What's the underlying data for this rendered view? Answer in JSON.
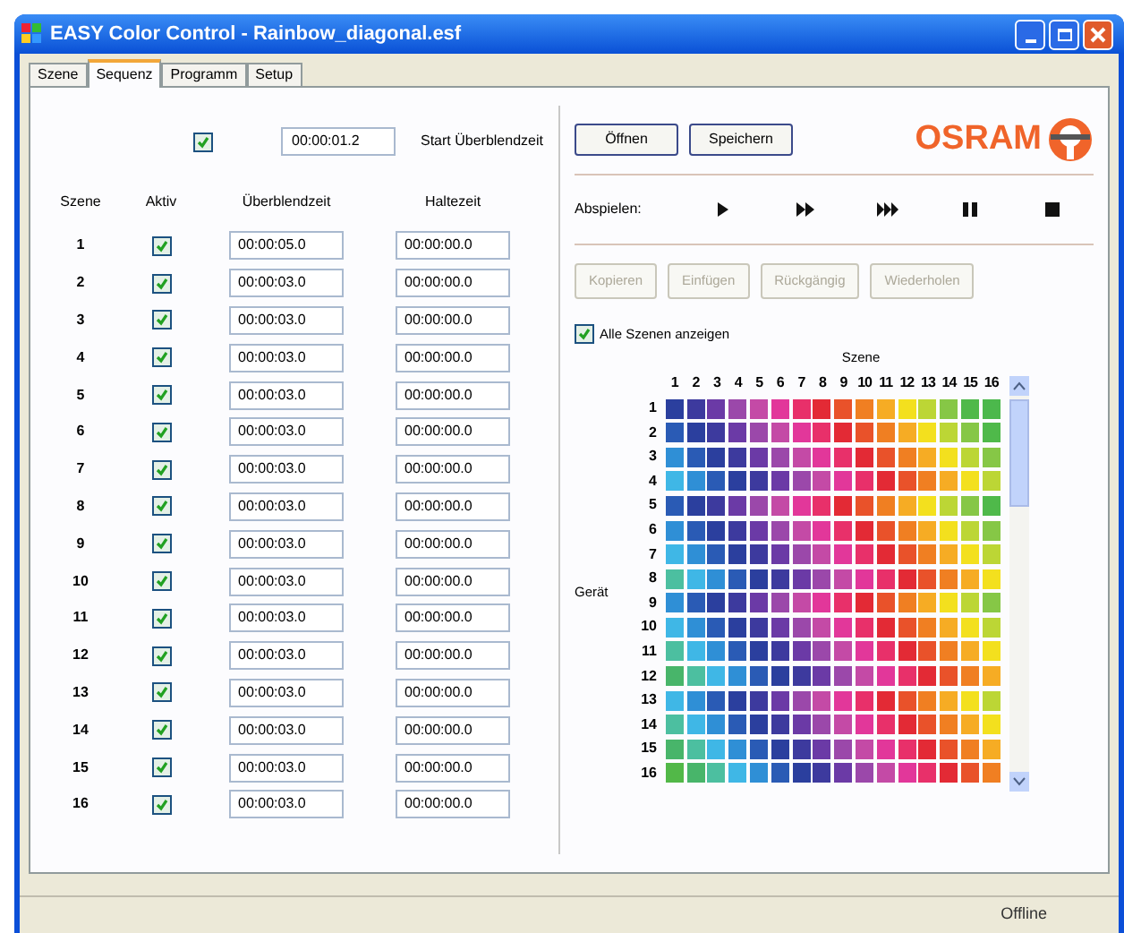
{
  "window": {
    "title": "EASY Color Control - Rainbow_diagonal.esf"
  },
  "tabs": [
    {
      "label": "Szene",
      "selected": false
    },
    {
      "label": "Sequenz",
      "selected": true
    },
    {
      "label": "Programm",
      "selected": false
    },
    {
      "label": "Setup",
      "selected": false
    }
  ],
  "sequence": {
    "start_fade": {
      "checked": true,
      "value": "00:00:01.2",
      "label": "Start Überblendzeit"
    },
    "columns": [
      "Szene",
      "Aktiv",
      "Überblendzeit",
      "Haltezeit"
    ],
    "rows": [
      {
        "scene": "1",
        "active": true,
        "fade": "00:00:05.0",
        "hold": "00:00:00.0"
      },
      {
        "scene": "2",
        "active": true,
        "fade": "00:00:03.0",
        "hold": "00:00:00.0"
      },
      {
        "scene": "3",
        "active": true,
        "fade": "00:00:03.0",
        "hold": "00:00:00.0"
      },
      {
        "scene": "4",
        "active": true,
        "fade": "00:00:03.0",
        "hold": "00:00:00.0"
      },
      {
        "scene": "5",
        "active": true,
        "fade": "00:00:03.0",
        "hold": "00:00:00.0"
      },
      {
        "scene": "6",
        "active": true,
        "fade": "00:00:03.0",
        "hold": "00:00:00.0"
      },
      {
        "scene": "7",
        "active": true,
        "fade": "00:00:03.0",
        "hold": "00:00:00.0"
      },
      {
        "scene": "8",
        "active": true,
        "fade": "00:00:03.0",
        "hold": "00:00:00.0"
      },
      {
        "scene": "9",
        "active": true,
        "fade": "00:00:03.0",
        "hold": "00:00:00.0"
      },
      {
        "scene": "10",
        "active": true,
        "fade": "00:00:03.0",
        "hold": "00:00:00.0"
      },
      {
        "scene": "11",
        "active": true,
        "fade": "00:00:03.0",
        "hold": "00:00:00.0"
      },
      {
        "scene": "12",
        "active": true,
        "fade": "00:00:03.0",
        "hold": "00:00:00.0"
      },
      {
        "scene": "13",
        "active": true,
        "fade": "00:00:03.0",
        "hold": "00:00:00.0"
      },
      {
        "scene": "14",
        "active": true,
        "fade": "00:00:03.0",
        "hold": "00:00:00.0"
      },
      {
        "scene": "15",
        "active": true,
        "fade": "00:00:03.0",
        "hold": "00:00:00.0"
      },
      {
        "scene": "16",
        "active": true,
        "fade": "00:00:03.0",
        "hold": "00:00:00.0"
      }
    ]
  },
  "file_buttons": [
    "Öffnen",
    "Speichern"
  ],
  "logo": "OSRAM",
  "playback": {
    "label": "Abspielen:",
    "controls": [
      {
        "kind": "play"
      },
      {
        "kind": "fast"
      },
      {
        "kind": "faster"
      },
      {
        "kind": "pause"
      },
      {
        "kind": "stop"
      }
    ]
  },
  "edit_buttons": [
    {
      "label": "Kopieren",
      "disabled": true
    },
    {
      "label": "Einfügen",
      "disabled": true
    },
    {
      "label": "Rückgängig",
      "disabled": true
    },
    {
      "label": "Wiederholen",
      "disabled": true
    }
  ],
  "show_all": {
    "label": "Alle Szenen anzeigen",
    "checked": true
  },
  "matrix": {
    "x_label": "Szene",
    "y_label": "Gerät",
    "columns": [
      "1",
      "2",
      "3",
      "4",
      "5",
      "6",
      "7",
      "8",
      "9",
      "10",
      "11",
      "12",
      "13",
      "14",
      "15",
      "16"
    ],
    "rows": [
      {
        "label": "1",
        "cells": [
          {
            "color": "#2b3f9e"
          },
          {
            "color": "#3d3a9e"
          },
          {
            "color": "#6b3aa6"
          },
          {
            "color": "#9b48aa"
          },
          {
            "color": "#c44aa6"
          },
          {
            "color": "#e2379a"
          },
          {
            "color": "#e8306a"
          },
          {
            "color": "#e32a35"
          },
          {
            "color": "#e9522a"
          },
          {
            "color": "#f07f22"
          },
          {
            "color": "#f6ac24"
          },
          {
            "color": "#f3e01e"
          },
          {
            "color": "#bcd635"
          },
          {
            "color": "#86c746"
          },
          {
            "color": "#4fb94a"
          },
          {
            "color": "#4cb84c"
          }
        ]
      },
      {
        "label": "2",
        "cells": [
          {
            "color": "#2a5bb5"
          },
          {
            "color": "#2b3f9e"
          },
          {
            "color": "#3d3a9e"
          },
          {
            "color": "#6b3aa6"
          },
          {
            "color": "#9b48aa"
          },
          {
            "color": "#c44aa6"
          },
          {
            "color": "#e2379a"
          },
          {
            "color": "#e8306a"
          },
          {
            "color": "#e32a35"
          },
          {
            "color": "#e9522a"
          },
          {
            "color": "#f07f22"
          },
          {
            "color": "#f6ac24"
          },
          {
            "color": "#f3e01e"
          },
          {
            "color": "#bcd635"
          },
          {
            "color": "#86c746"
          },
          {
            "color": "#4fb94a"
          }
        ]
      },
      {
        "label": "3",
        "cells": [
          {
            "color": "#2f8fd6"
          },
          {
            "color": "#2a5bb5"
          },
          {
            "color": "#2b3f9e"
          },
          {
            "color": "#3d3a9e"
          },
          {
            "color": "#6b3aa6"
          },
          {
            "color": "#9b48aa"
          },
          {
            "color": "#c44aa6"
          },
          {
            "color": "#e2379a"
          },
          {
            "color": "#e8306a"
          },
          {
            "color": "#e32a35"
          },
          {
            "color": "#e9522a"
          },
          {
            "color": "#f07f22"
          },
          {
            "color": "#f6ac24"
          },
          {
            "color": "#f3e01e"
          },
          {
            "color": "#bcd635"
          },
          {
            "color": "#86c746"
          }
        ]
      },
      {
        "label": "4",
        "cells": [
          {
            "color": "#3fb7e6"
          },
          {
            "color": "#2f8fd6"
          },
          {
            "color": "#2a5bb5"
          },
          {
            "color": "#2b3f9e"
          },
          {
            "color": "#3d3a9e"
          },
          {
            "color": "#6b3aa6"
          },
          {
            "color": "#9b48aa"
          },
          {
            "color": "#c44aa6"
          },
          {
            "color": "#e2379a"
          },
          {
            "color": "#e8306a"
          },
          {
            "color": "#e32a35"
          },
          {
            "color": "#e9522a"
          },
          {
            "color": "#f07f22"
          },
          {
            "color": "#f6ac24"
          },
          {
            "color": "#f3e01e"
          },
          {
            "color": "#bcd635"
          }
        ]
      },
      {
        "label": "5",
        "cells": [
          {
            "color": "#2a5bb5"
          },
          {
            "color": "#2b3f9e"
          },
          {
            "color": "#3d3a9e"
          },
          {
            "color": "#6b3aa6"
          },
          {
            "color": "#9b48aa"
          },
          {
            "color": "#c44aa6"
          },
          {
            "color": "#e2379a"
          },
          {
            "color": "#e8306a"
          },
          {
            "color": "#e32a35"
          },
          {
            "color": "#e9522a"
          },
          {
            "color": "#f07f22"
          },
          {
            "color": "#f6ac24"
          },
          {
            "color": "#f3e01e"
          },
          {
            "color": "#bcd635"
          },
          {
            "color": "#86c746"
          },
          {
            "color": "#4fb94a"
          }
        ]
      },
      {
        "label": "6",
        "cells": [
          {
            "color": "#2f8fd6"
          },
          {
            "color": "#2a5bb5"
          },
          {
            "color": "#2b3f9e"
          },
          {
            "color": "#3d3a9e"
          },
          {
            "color": "#6b3aa6"
          },
          {
            "color": "#9b48aa"
          },
          {
            "color": "#c44aa6"
          },
          {
            "color": "#e2379a"
          },
          {
            "color": "#e8306a"
          },
          {
            "color": "#e32a35"
          },
          {
            "color": "#e9522a"
          },
          {
            "color": "#f07f22"
          },
          {
            "color": "#f6ac24"
          },
          {
            "color": "#f3e01e"
          },
          {
            "color": "#bcd635"
          },
          {
            "color": "#86c746"
          }
        ]
      },
      {
        "label": "7",
        "cells": [
          {
            "color": "#3fb7e6"
          },
          {
            "color": "#2f8fd6"
          },
          {
            "color": "#2a5bb5"
          },
          {
            "color": "#2b3f9e"
          },
          {
            "color": "#3d3a9e"
          },
          {
            "color": "#6b3aa6"
          },
          {
            "color": "#9b48aa"
          },
          {
            "color": "#c44aa6"
          },
          {
            "color": "#e2379a"
          },
          {
            "color": "#e8306a"
          },
          {
            "color": "#e32a35"
          },
          {
            "color": "#e9522a"
          },
          {
            "color": "#f07f22"
          },
          {
            "color": "#f6ac24"
          },
          {
            "color": "#f3e01e"
          },
          {
            "color": "#bcd635"
          }
        ]
      },
      {
        "label": "8",
        "cells": [
          {
            "color": "#4cbfa0"
          },
          {
            "color": "#3fb7e6"
          },
          {
            "color": "#2f8fd6"
          },
          {
            "color": "#2a5bb5"
          },
          {
            "color": "#2b3f9e"
          },
          {
            "color": "#3d3a9e"
          },
          {
            "color": "#6b3aa6"
          },
          {
            "color": "#9b48aa"
          },
          {
            "color": "#c44aa6"
          },
          {
            "color": "#e2379a"
          },
          {
            "color": "#e8306a"
          },
          {
            "color": "#e32a35"
          },
          {
            "color": "#e9522a"
          },
          {
            "color": "#f07f22"
          },
          {
            "color": "#f6ac24"
          },
          {
            "color": "#f3e01e"
          }
        ]
      },
      {
        "label": "9",
        "cells": [
          {
            "color": "#2f8fd6"
          },
          {
            "color": "#2a5bb5"
          },
          {
            "color": "#2b3f9e"
          },
          {
            "color": "#3d3a9e"
          },
          {
            "color": "#6b3aa6"
          },
          {
            "color": "#9b48aa"
          },
          {
            "color": "#c44aa6"
          },
          {
            "color": "#e2379a"
          },
          {
            "color": "#e8306a"
          },
          {
            "color": "#e32a35"
          },
          {
            "color": "#e9522a"
          },
          {
            "color": "#f07f22"
          },
          {
            "color": "#f6ac24"
          },
          {
            "color": "#f3e01e"
          },
          {
            "color": "#bcd635"
          },
          {
            "color": "#86c746"
          }
        ]
      },
      {
        "label": "10",
        "cells": [
          {
            "color": "#3fb7e6"
          },
          {
            "color": "#2f8fd6"
          },
          {
            "color": "#2a5bb5"
          },
          {
            "color": "#2b3f9e"
          },
          {
            "color": "#3d3a9e"
          },
          {
            "color": "#6b3aa6"
          },
          {
            "color": "#9b48aa"
          },
          {
            "color": "#c44aa6"
          },
          {
            "color": "#e2379a"
          },
          {
            "color": "#e8306a"
          },
          {
            "color": "#e32a35"
          },
          {
            "color": "#e9522a"
          },
          {
            "color": "#f07f22"
          },
          {
            "color": "#f6ac24"
          },
          {
            "color": "#f3e01e"
          },
          {
            "color": "#bcd635"
          }
        ]
      },
      {
        "label": "11",
        "cells": [
          {
            "color": "#4cbfa0"
          },
          {
            "color": "#3fb7e6"
          },
          {
            "color": "#2f8fd6"
          },
          {
            "color": "#2a5bb5"
          },
          {
            "color": "#2b3f9e"
          },
          {
            "color": "#3d3a9e"
          },
          {
            "color": "#6b3aa6"
          },
          {
            "color": "#9b48aa"
          },
          {
            "color": "#c44aa6"
          },
          {
            "color": "#e2379a"
          },
          {
            "color": "#e8306a"
          },
          {
            "color": "#e32a35"
          },
          {
            "color": "#e9522a"
          },
          {
            "color": "#f07f22"
          },
          {
            "color": "#f6ac24"
          },
          {
            "color": "#f3e01e"
          }
        ]
      },
      {
        "label": "12",
        "cells": [
          {
            "color": "#48b56a"
          },
          {
            "color": "#4cbfa0"
          },
          {
            "color": "#3fb7e6"
          },
          {
            "color": "#2f8fd6"
          },
          {
            "color": "#2a5bb5"
          },
          {
            "color": "#2b3f9e"
          },
          {
            "color": "#3d3a9e"
          },
          {
            "color": "#6b3aa6"
          },
          {
            "color": "#9b48aa"
          },
          {
            "color": "#c44aa6"
          },
          {
            "color": "#e2379a"
          },
          {
            "color": "#e8306a"
          },
          {
            "color": "#e32a35"
          },
          {
            "color": "#e9522a"
          },
          {
            "color": "#f07f22"
          },
          {
            "color": "#f6ac24"
          }
        ]
      },
      {
        "label": "13",
        "cells": [
          {
            "color": "#3fb7e6"
          },
          {
            "color": "#2f8fd6"
          },
          {
            "color": "#2a5bb5"
          },
          {
            "color": "#2b3f9e"
          },
          {
            "color": "#3d3a9e"
          },
          {
            "color": "#6b3aa6"
          },
          {
            "color": "#9b48aa"
          },
          {
            "color": "#c44aa6"
          },
          {
            "color": "#e2379a"
          },
          {
            "color": "#e8306a"
          },
          {
            "color": "#e32a35"
          },
          {
            "color": "#e9522a"
          },
          {
            "color": "#f07f22"
          },
          {
            "color": "#f6ac24"
          },
          {
            "color": "#f3e01e"
          },
          {
            "color": "#bcd635"
          }
        ]
      },
      {
        "label": "14",
        "cells": [
          {
            "color": "#4cbfa0"
          },
          {
            "color": "#3fb7e6"
          },
          {
            "color": "#2f8fd6"
          },
          {
            "color": "#2a5bb5"
          },
          {
            "color": "#2b3f9e"
          },
          {
            "color": "#3d3a9e"
          },
          {
            "color": "#6b3aa6"
          },
          {
            "color": "#9b48aa"
          },
          {
            "color": "#c44aa6"
          },
          {
            "color": "#e2379a"
          },
          {
            "color": "#e8306a"
          },
          {
            "color": "#e32a35"
          },
          {
            "color": "#e9522a"
          },
          {
            "color": "#f07f22"
          },
          {
            "color": "#f6ac24"
          },
          {
            "color": "#f3e01e"
          }
        ]
      },
      {
        "label": "15",
        "cells": [
          {
            "color": "#48b56a"
          },
          {
            "color": "#4cbfa0"
          },
          {
            "color": "#3fb7e6"
          },
          {
            "color": "#2f8fd6"
          },
          {
            "color": "#2a5bb5"
          },
          {
            "color": "#2b3f9e"
          },
          {
            "color": "#3d3a9e"
          },
          {
            "color": "#6b3aa6"
          },
          {
            "color": "#9b48aa"
          },
          {
            "color": "#c44aa6"
          },
          {
            "color": "#e2379a"
          },
          {
            "color": "#e8306a"
          },
          {
            "color": "#e32a35"
          },
          {
            "color": "#e9522a"
          },
          {
            "color": "#f07f22"
          },
          {
            "color": "#f6ac24"
          }
        ]
      },
      {
        "label": "16",
        "cells": [
          {
            "color": "#52b848"
          },
          {
            "color": "#48b56a"
          },
          {
            "color": "#4cbfa0"
          },
          {
            "color": "#3fb7e6"
          },
          {
            "color": "#2f8fd6"
          },
          {
            "color": "#2a5bb5"
          },
          {
            "color": "#2b3f9e"
          },
          {
            "color": "#3d3a9e"
          },
          {
            "color": "#6b3aa6"
          },
          {
            "color": "#9b48aa"
          },
          {
            "color": "#c44aa6"
          },
          {
            "color": "#e2379a"
          },
          {
            "color": "#e8306a"
          },
          {
            "color": "#e32a35"
          },
          {
            "color": "#e9522a"
          },
          {
            "color": "#f07f22"
          }
        ]
      }
    ]
  },
  "status_bar": {
    "text": "Offline"
  }
}
